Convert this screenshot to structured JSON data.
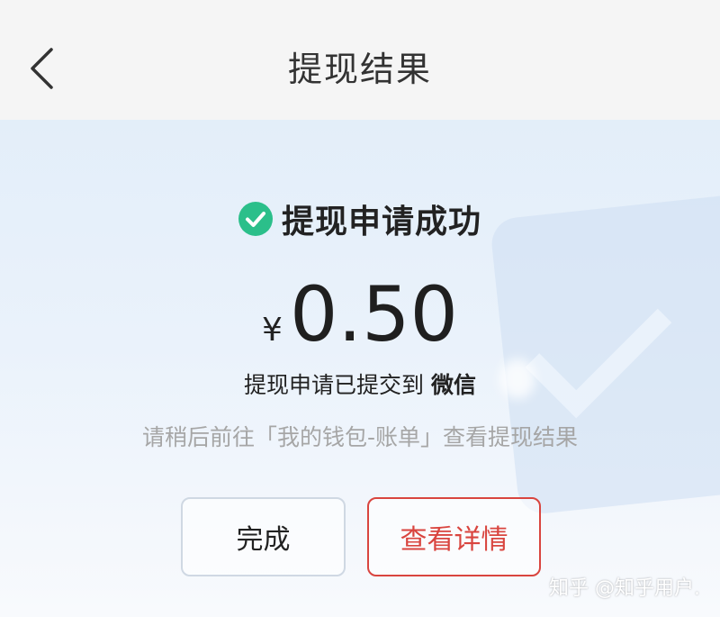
{
  "header": {
    "title": "提现结果"
  },
  "status": {
    "text": "提现申请成功",
    "icon": "check-circle-icon",
    "color": "#2bbf8a"
  },
  "amount": {
    "currency": "¥",
    "value": "0.50"
  },
  "message": {
    "prefix": "提现申请已提交到 ",
    "channel": "微信"
  },
  "hint": "请稍后前往「我的钱包-账单」查看提现结果",
  "buttons": {
    "done_label": "完成",
    "detail_label": "查看详情",
    "detail_color": "#d9453f"
  },
  "watermark": "知乎 @知乎用户."
}
